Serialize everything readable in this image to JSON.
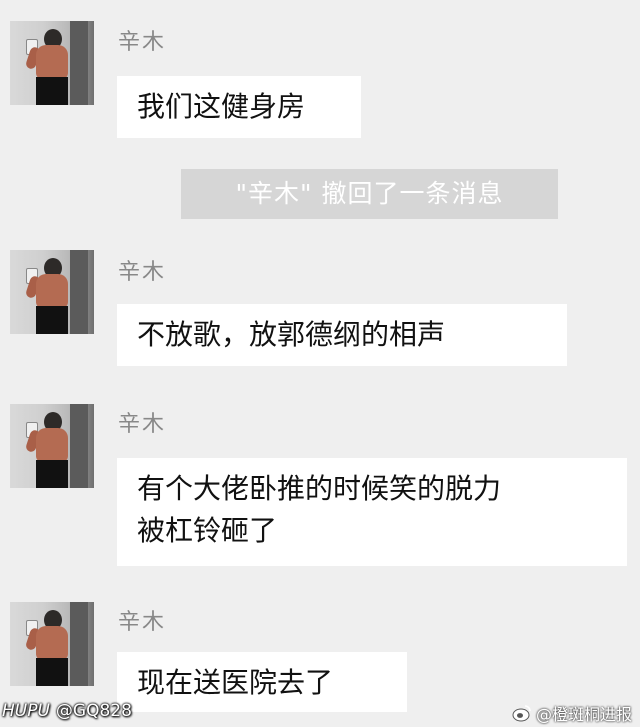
{
  "sender_name": "辛木",
  "messages": [
    {
      "lines": [
        "我们这健身房"
      ]
    },
    {
      "lines": [
        "不放歌，放郭德纲的相声"
      ]
    },
    {
      "lines": [
        "有个大佬卧推的时候笑的脱力",
        "被杠铃砸了"
      ]
    },
    {
      "lines": [
        "现在送医院去了"
      ]
    }
  ],
  "system_notice": "\"辛木\" 撤回了一条消息",
  "watermark": {
    "left_brand": "HUPU",
    "left_handle": "@GQ828",
    "right_text": "@橙斑桐进报"
  },
  "icons": {
    "avatar": "person-photo-avatar",
    "weibo": "weibo-icon"
  }
}
